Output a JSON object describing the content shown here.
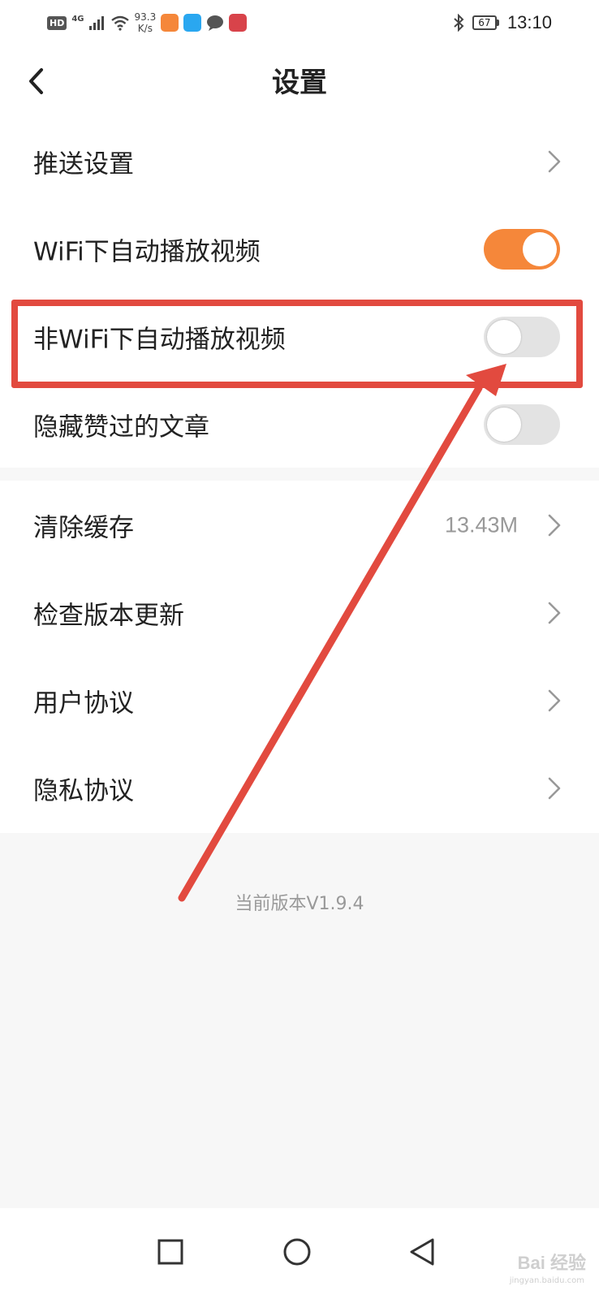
{
  "status_bar": {
    "hd": "HD",
    "network": "4G",
    "speed_value": "93.3",
    "speed_unit": "K/s",
    "battery": "67",
    "time": "13:10",
    "icons": [
      "signal-icon",
      "wifi-icon",
      "bluetooth-icon",
      "battery-icon"
    ]
  },
  "header": {
    "title": "设置",
    "back_icon": "chevron-left-icon"
  },
  "settings": {
    "push": {
      "label": "推送设置"
    },
    "wifi_autoplay": {
      "label": "WiFi下自动播放视频",
      "enabled": true
    },
    "non_wifi_autoplay": {
      "label": "非WiFi下自动播放视频",
      "enabled": false
    },
    "hide_liked": {
      "label": "隐藏赞过的文章",
      "enabled": false
    },
    "clear_cache": {
      "label": "清除缓存",
      "value": "13.43M"
    },
    "check_update": {
      "label": "检查版本更新"
    },
    "user_agreement": {
      "label": "用户协议"
    },
    "privacy_policy": {
      "label": "隐私协议"
    }
  },
  "footer": {
    "version": "当前版本V1.9.4"
  },
  "annotation": {
    "color": "#e24a3f"
  },
  "colors": {
    "accent": "#f5873a",
    "toggle_off": "#e3e3e3",
    "background": "#f7f7f7"
  },
  "watermark": {
    "text": "Bai 经验",
    "sub": "jingyan.baidu.com"
  }
}
